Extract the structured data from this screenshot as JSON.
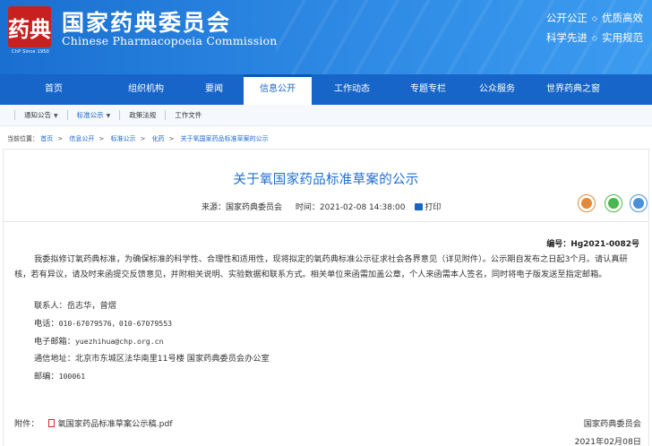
{
  "header": {
    "logo_text": "药典",
    "logo_sub": "ChP  Since 1950",
    "title_cn": "国家药典委员会",
    "title_en": "Chinese Pharmacopoeia Commission",
    "slogan_line1": [
      "公开公正",
      "优质高效"
    ],
    "slogan_line2": [
      "科学先进",
      "实用规范"
    ]
  },
  "nav": {
    "items": [
      "首页",
      "组织机构",
      "要闻",
      "信息公开",
      "工作动态",
      "专题专栏",
      "公众服务",
      "世界药典之窗"
    ],
    "active_index": 3
  },
  "subnav": {
    "items": [
      {
        "label": "通知公告",
        "has_caret": true
      },
      {
        "label": "标准公示",
        "has_caret": true
      },
      {
        "label": "政策法规",
        "has_caret": false
      },
      {
        "label": "工作文件",
        "has_caret": false
      }
    ]
  },
  "breadcrumb": {
    "prefix": "当前位置：",
    "items": [
      "首页",
      "信息公开",
      "标准公示",
      "化药",
      "关于氧国家药品标准草案的公示"
    ],
    "sep": ">"
  },
  "article": {
    "title": "关于氧国家药品标准草案的公示",
    "source_label": "来源：国家药典委员会",
    "time_label": "时间：2021-02-08 14:38:00",
    "print_label": "打印",
    "doc_number": "编号：Hg2021-0082号",
    "paragraph": "我委拟修订氧药典标准，为确保标准的科学性、合理性和适用性，现将拟定的氧药典标准公示征求社会各界意见（详见附件）。公示期自发布之日起3个月。请认真研核，若有异议，请及时来函提交反馈意见，并附相关说明、实验数据和联系方式。相关单位来函需加盖公章，个人来函需本人签名，同时将电子版发送至指定邮箱。",
    "contacts": {
      "person": "联系人：岳志华，曾熠",
      "phone_label": "电话：",
      "phone": "010-67079576，010-67079553",
      "email_label": "电子邮箱：",
      "email": "yuezhihua@chp.org.cn",
      "address": "通信地址：北京市东城区法华南里11号楼  国家药典委员会办公室",
      "zip_label": "邮编：",
      "zip": "100061"
    },
    "attachment_label": "附件：",
    "attachment_file": "氧国家药品标准草案公示稿.pdf",
    "sign_org": "国家药典委员会",
    "sign_date": "2021年02月08日"
  },
  "share": {
    "icons": [
      "weibo-icon",
      "wechat-icon",
      "qzone-icon"
    ]
  },
  "colors": {
    "brand_blue": "#1765c8",
    "title_blue": "#1f6ed4",
    "logo_red": "#c8201e"
  }
}
